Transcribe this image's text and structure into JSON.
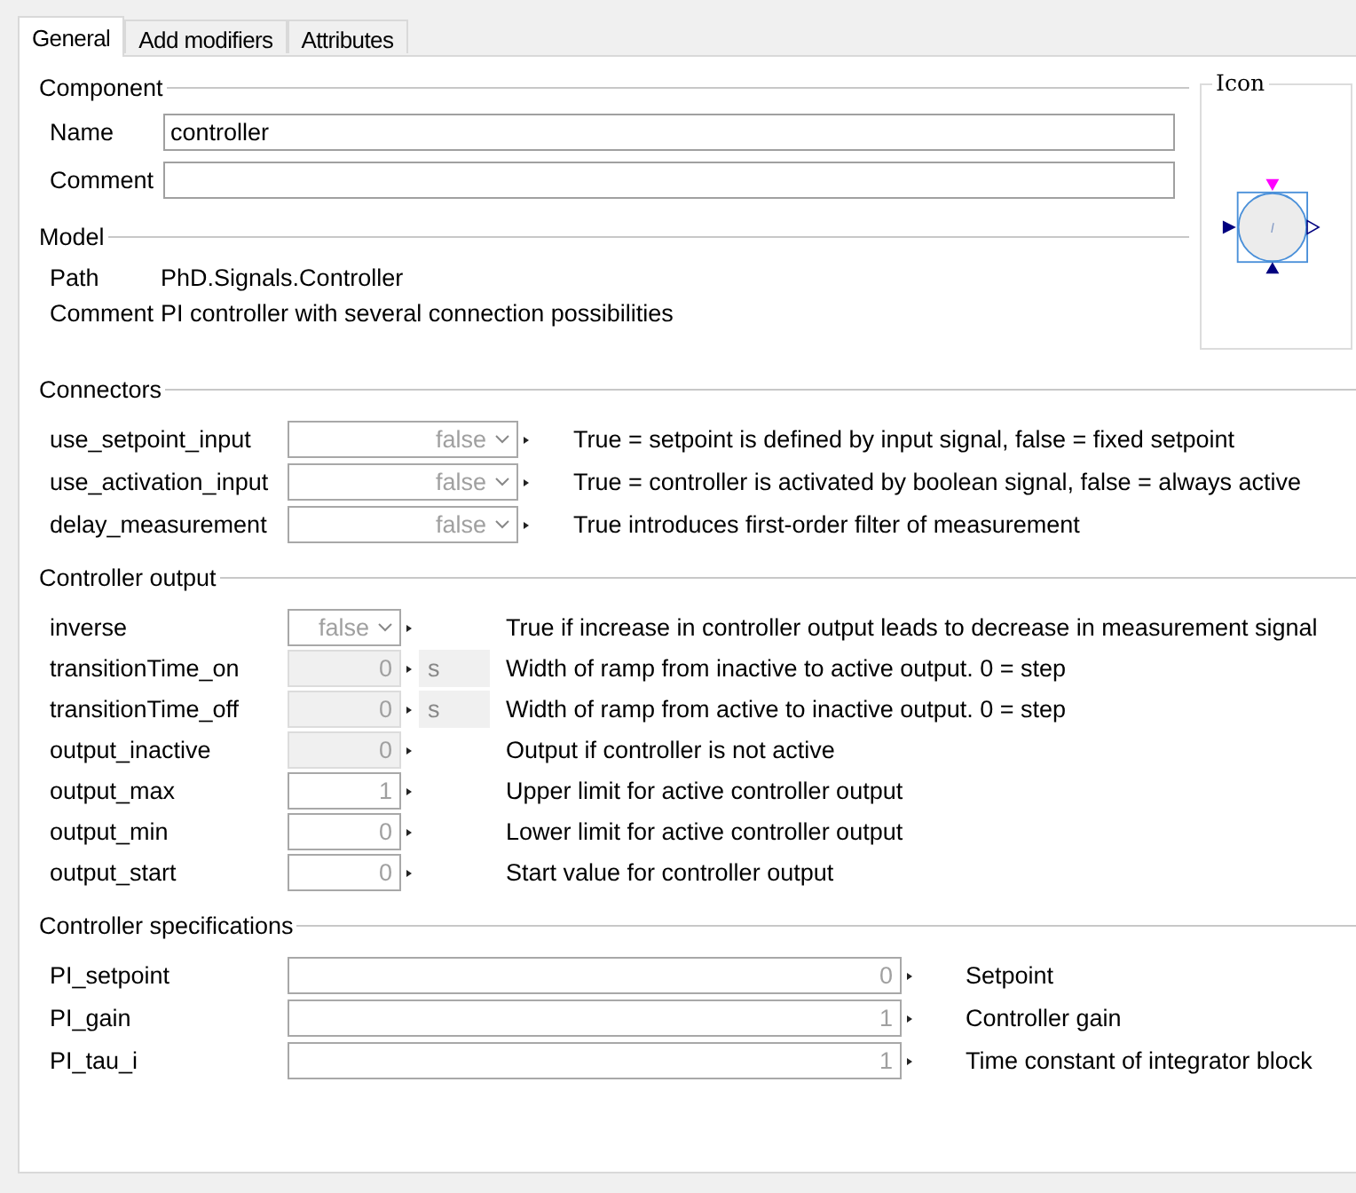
{
  "tabs": [
    {
      "label": "General",
      "selected": true
    },
    {
      "label": "Add modifiers",
      "selected": false
    },
    {
      "label": "Attributes",
      "selected": false
    }
  ],
  "component": {
    "title": "Component",
    "fields": [
      {
        "label": "Name",
        "value": "controller"
      },
      {
        "label": "Comment"
      }
    ]
  },
  "model": {
    "title": "Model",
    "rows": [
      {
        "label": "Path",
        "text": "PhD.Signals.Controller"
      },
      {
        "label": "Comment",
        "text": "PI controller with several connection possibilities"
      }
    ]
  },
  "icon_panel": {
    "title": "Icon",
    "symbol": "I"
  },
  "sections": [
    {
      "title": "Connectors",
      "params": [
        {
          "name": "use_setpoint_input",
          "kind": "combo",
          "placeholder": "false",
          "disabled": false,
          "description": "True = setpoint is defined by input signal, false = fixed setpoint"
        },
        {
          "name": "use_activation_input",
          "kind": "combo",
          "placeholder": "false",
          "disabled": false,
          "description": "True = controller is activated by boolean signal, false = always active"
        },
        {
          "name": "delay_measurement",
          "kind": "combo",
          "placeholder": "false",
          "disabled": false,
          "description": "True introduces first-order filter of measurement"
        }
      ]
    },
    {
      "title": "Controller output",
      "params": [
        {
          "name": "inverse",
          "kind": "combo",
          "placeholder": "false",
          "disabled": false,
          "description": "True if increase in controller output leads to decrease in measurement signal"
        },
        {
          "name": "transitionTime_on",
          "kind": "number",
          "placeholder": "0",
          "disabled": true,
          "unit": "s",
          "description": "Width of ramp from inactive to active output. 0 = step"
        },
        {
          "name": "transitionTime_off",
          "kind": "number",
          "placeholder": "0",
          "disabled": true,
          "unit": "s",
          "description": "Width of ramp from active to inactive output. 0 = step"
        },
        {
          "name": "output_inactive",
          "kind": "number",
          "placeholder": "0",
          "disabled": true,
          "description": "Output if controller is not active"
        },
        {
          "name": "output_max",
          "kind": "number",
          "placeholder": "1",
          "disabled": false,
          "description": "Upper limit for active controller output"
        },
        {
          "name": "output_min",
          "kind": "number",
          "placeholder": "0",
          "disabled": false,
          "description": "Lower limit for active controller output"
        },
        {
          "name": "output_start",
          "kind": "number",
          "placeholder": "0",
          "disabled": false,
          "description": "Start value for controller output"
        }
      ]
    },
    {
      "title": "Controller specifications",
      "params": [
        {
          "name": "PI_setpoint",
          "kind": "number",
          "placeholder": "0",
          "disabled": false,
          "description": "Setpoint"
        },
        {
          "name": "PI_gain",
          "kind": "number",
          "placeholder": "1",
          "disabled": false,
          "description": "Controller gain"
        },
        {
          "name": "PI_tau_i",
          "kind": "number",
          "placeholder": "1",
          "disabled": false,
          "description": "Time constant of integrator block"
        }
      ]
    }
  ]
}
